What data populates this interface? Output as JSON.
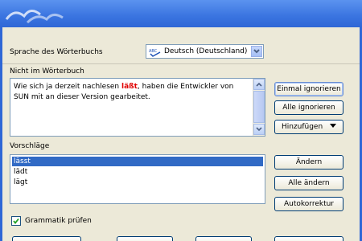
{
  "colors": {
    "titlebar": "#3a74e0",
    "highlight_word": "#e00000",
    "selection": "#316ac5",
    "client": "#ece9d8"
  },
  "icons": {
    "app_logo": "seagull-logo-icon",
    "language": "abc-spellcheck-icon",
    "dropdown": "chevron-down-icon",
    "checkbox": "checkmark-icon"
  },
  "dictionary": {
    "label": "Sprache des Wörterbuchs",
    "value": "Deutsch (Deutschland)"
  },
  "not_in_dictionary": {
    "label": "Nicht im Wörterbuch",
    "text_before": "Wie sich ja derzeit nachlesen ",
    "flagged_word": "läßt",
    "text_after": ", haben die Entwickler von SUN mit an dieser Version gearbeitet."
  },
  "suggestions": {
    "label": "Vorschläge",
    "items": [
      "lässt",
      "lädt",
      "lägt"
    ],
    "selected_index": 0
  },
  "buttons": {
    "ignore_once": "Einmal ignorieren",
    "ignore_all": "Alle ignorieren",
    "add": "Hinzufügen",
    "change": "Ändern",
    "change_all": "Alle ändern",
    "autocorrect": "Autokorrektur"
  },
  "grammar_check": {
    "label": "Grammatik prüfen",
    "checked": true
  }
}
